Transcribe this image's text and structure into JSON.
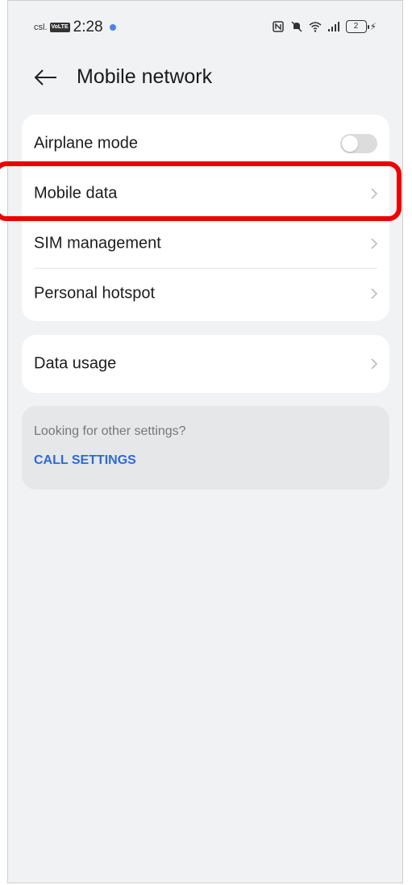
{
  "status_bar": {
    "carrier": "csl.",
    "network_badge": "VoLTE",
    "time": "2:28",
    "battery_level": "2",
    "icons": [
      "nfc-icon",
      "mute-icon",
      "wifi-icon",
      "signal-icon",
      "battery-icon",
      "charging-icon"
    ]
  },
  "header": {
    "back_icon": "arrow-left-icon",
    "title": "Mobile network"
  },
  "main_card": {
    "items": [
      {
        "label": "Airplane mode",
        "control": "toggle",
        "state": "off"
      },
      {
        "label": "Mobile data",
        "control": "chevron",
        "highlighted": true
      },
      {
        "label": "SIM management",
        "control": "chevron"
      },
      {
        "label": "Personal hotspot",
        "control": "chevron"
      }
    ]
  },
  "usage_card": {
    "items": [
      {
        "label": "Data usage",
        "control": "chevron"
      }
    ]
  },
  "info_card": {
    "text": "Looking for other settings?",
    "link": "CALL SETTINGS"
  },
  "colors": {
    "background": "#f1f2f4",
    "card": "#ffffff",
    "link": "#2d6ad3",
    "highlight": "#ee0000",
    "toggle_off": "#dcdcdc"
  }
}
